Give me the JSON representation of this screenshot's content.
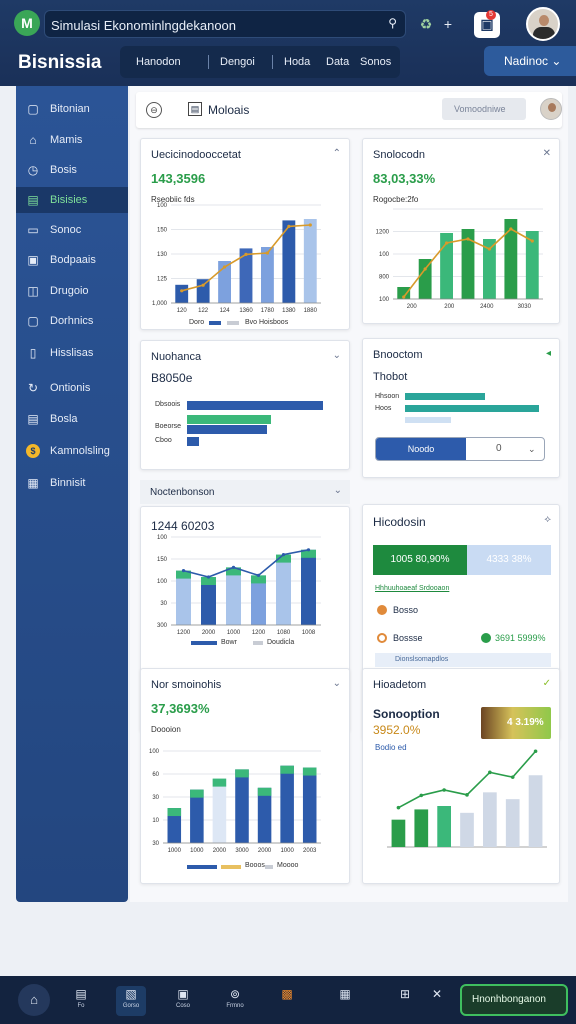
{
  "app": {
    "title": "Simulasi Ekonominlngdekanoon",
    "brand": "Bisnissia",
    "logo": "M",
    "user_menu": "Nadinoc ⌄",
    "notif_count": "5"
  },
  "topnav": [
    "Hanodon",
    "Dengoi",
    "Hoda",
    "Data",
    "Sonos"
  ],
  "sidebar": {
    "items": [
      {
        "label": "Bitonian",
        "icon": "square-icon"
      },
      {
        "label": "Mamis",
        "icon": "building-icon"
      },
      {
        "label": "Bosis",
        "icon": "clock-icon"
      },
      {
        "label": "Bisisies",
        "icon": "doc-icon",
        "active": true
      },
      {
        "label": "Sonoc",
        "icon": "folder-icon"
      },
      {
        "label": "Bodpaais",
        "icon": "box-icon"
      },
      {
        "label": "Drugoio",
        "icon": "chat-icon"
      },
      {
        "label": "Dorhnics",
        "icon": "window-icon"
      },
      {
        "label": "Hisslisas",
        "icon": "file-icon"
      },
      {
        "label": "Ontionis",
        "icon": "refresh-icon"
      },
      {
        "label": "Bosla",
        "icon": "doc-icon"
      },
      {
        "label": "Kamnolsling",
        "icon": "coin-icon"
      },
      {
        "label": "Binnisit",
        "icon": "grid-icon"
      }
    ]
  },
  "main": {
    "title": "Moloais",
    "select": "Vomoodniwe",
    "back": "⊖"
  },
  "cards": {
    "c1": {
      "title": "Uecicinodooccetat",
      "value": "143,3596",
      "sub": "Rseobiic fds",
      "legend": [
        "Doro",
        "Bvo Hoisboos"
      ]
    },
    "c2": {
      "title": "Snolocodn",
      "value": "83,03,33%",
      "sub": "Rogocbe:2fo"
    },
    "c3": {
      "title": "Nuohanca",
      "value": "B8050e",
      "rows": [
        "Dbsoois",
        "Boeorse",
        "Cboo"
      ]
    },
    "c4": {
      "title": "Bnooctom",
      "value": "Thobot",
      "rows": [
        "Hhsoon",
        "Hoos"
      ],
      "btn": "Noodo",
      "btn2": "0"
    },
    "c5": {
      "title": "Noctenbonson",
      "value": "1244 60203",
      "legend": [
        "Bowr",
        "Doudicla"
      ]
    },
    "c6": {
      "title": "Hicodosin",
      "split": [
        "1005 80,90%",
        "4333 38%"
      ],
      "link": "Hhhuuhoaeaf Srdooaon",
      "items": [
        "Bosso",
        "Bossse",
        "Dionslsomapdlos"
      ],
      "badge": "3691 5999%"
    },
    "c7": {
      "title": "Nor smoinohis",
      "value": "37,3693%",
      "sub": "Doooion",
      "legend": [
        "Doolo",
        "Booos",
        "Moooo"
      ]
    },
    "c8": {
      "title": "Hioadetom",
      "value": "Sonooption",
      "value2": "3952.0%",
      "pct": "4 3.19%",
      "tag": "Bodio ed"
    }
  },
  "chart_data": [
    {
      "type": "bar",
      "title": "Uecicinodooccetat",
      "categories": [
        "120",
        "122",
        "124",
        "1360",
        "1780",
        "1380",
        "1880"
      ],
      "series": [
        {
          "name": "Doro",
          "values": [
            1.3,
            1.7,
            3.0,
            3.9,
            4.0,
            5.9,
            6.0
          ]
        }
      ],
      "ylim": [
        0,
        7
      ],
      "yticks": [
        "1,000",
        "125",
        "130",
        "150",
        "100",
        "3.00",
        "5.0"
      ]
    },
    {
      "type": "bar",
      "title": "Snolocodn",
      "categories": [
        "200",
        "200",
        "2400",
        "3030"
      ],
      "series": [
        {
          "name": "a",
          "values": [
            0.6,
            2.0,
            3.3,
            3.5,
            3.0,
            4.0,
            3.4
          ]
        }
      ],
      "yticks": [
        "100",
        "800",
        "100",
        "1200"
      ]
    },
    {
      "type": "bar",
      "title": "Noctenbonson",
      "categories": [
        "1200",
        "2000",
        "1000",
        "1200",
        "1080",
        "1008"
      ],
      "series": [
        {
          "name": "Bowr",
          "values": [
            3.4,
            3.0,
            3.6,
            3.1,
            4.4,
            4.7
          ]
        }
      ],
      "yticks": [
        "300",
        "30",
        "100",
        "150",
        "100"
      ]
    },
    {
      "type": "bar",
      "title": "Nor smoinohis",
      "categories": [
        "1000",
        "1000",
        "2000",
        "3000",
        "2000",
        "1000",
        "2003"
      ],
      "series": [
        {
          "name": "Doolo",
          "values": [
            1.9,
            2.9,
            3.5,
            4.0,
            3.0,
            4.2,
            4.1
          ]
        }
      ],
      "yticks": [
        "30",
        "10",
        "30",
        "60",
        "100",
        "58"
      ]
    }
  ],
  "taskbar": [
    "Fo",
    "Gorso",
    "Coso",
    "Frmno",
    "",
    "",
    "",
    "",
    ""
  ],
  "taskbar_action": "Hnonhbonganon",
  "colors": {
    "navy": "#1f3a66",
    "blue": "#2d5b9c",
    "green": "#2a9d4a",
    "light": "#a9c4ea"
  }
}
